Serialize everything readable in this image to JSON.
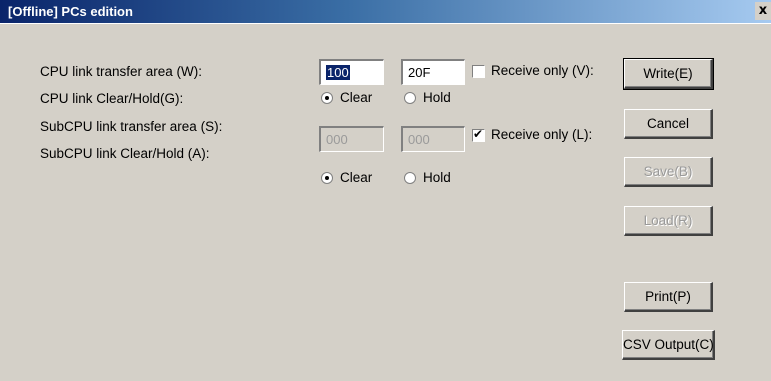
{
  "window": {
    "title": "[Offline] PCs edition",
    "close_glyph": "x"
  },
  "rows": [
    {
      "label": "CPU link transfer area (W):"
    },
    {
      "label": "CPU link Clear/Hold(G):"
    },
    {
      "label": "SubCPU link transfer area (S):"
    },
    {
      "label": "SubCPU link Clear/Hold (A):"
    }
  ],
  "cpu_link": {
    "start": "100",
    "end": "20F",
    "receive_only_label": "Receive only (V):",
    "receive_only_checked": false,
    "clear_label": "Clear",
    "hold_label": "Hold",
    "selected": "Clear"
  },
  "subcpu_link": {
    "start": "000",
    "end": "000",
    "receive_only_label": "Receive only (L):",
    "receive_only_checked": true,
    "clear_label": "Clear",
    "hold_label": "Hold",
    "selected": "Clear"
  },
  "buttons": {
    "write": "Write(E)",
    "cancel": "Cancel",
    "save": "Save(B)",
    "load": "Load(R)",
    "print": "Print(P)",
    "csv": "CSV Output(C)"
  },
  "icons": {
    "check": "✔"
  },
  "colors": {
    "dialog_bg": "#d4d0c8",
    "title_start": "#0a246a",
    "title_end": "#a6caf0",
    "selection": "#0a246a"
  }
}
